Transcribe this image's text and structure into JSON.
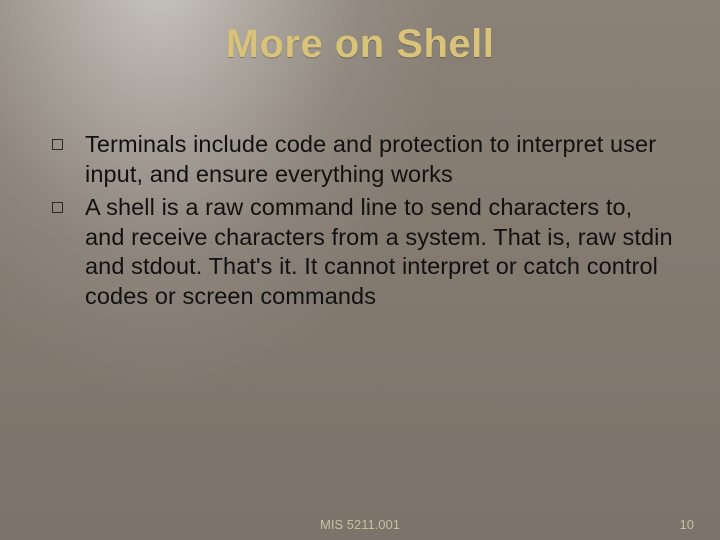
{
  "title": "More on Shell",
  "bullets": [
    "Terminals include code and protection to interpret user input, and ensure everything works",
    "A shell is a raw command line to send characters to, and receive characters from a system.  That is, raw stdin and stdout.  That's it.  It cannot interpret or catch control codes or screen commands"
  ],
  "footer": {
    "course": "MIS 5211.001",
    "page": "10"
  }
}
